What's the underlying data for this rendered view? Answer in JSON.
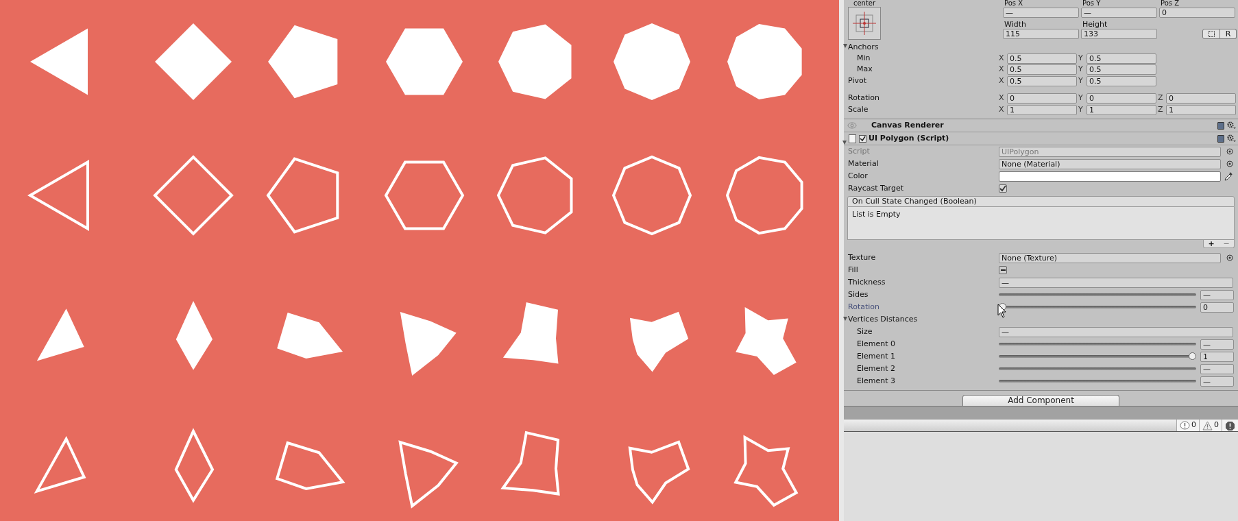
{
  "game_view": {
    "rows": [
      {
        "kind": "solid"
      },
      {
        "kind": "outline"
      },
      {
        "kind": "warped"
      },
      {
        "kind": "warped-outline"
      }
    ]
  },
  "rect_transform": {
    "preset_label": "center",
    "position": [
      {
        "label": "Pos X",
        "value": "—"
      },
      {
        "label": "Pos Y",
        "value": "—"
      },
      {
        "label": "Pos Z",
        "value": "0"
      }
    ],
    "size": [
      {
        "label": "Width",
        "value": "115"
      },
      {
        "label": "Height",
        "value": "133"
      }
    ],
    "raw_button": "R",
    "anchors": {
      "label": "Anchors",
      "expanded": true,
      "children": [
        {
          "label": "Min",
          "axes": [
            {
              "axis": "X",
              "value": "0.5"
            },
            {
              "axis": "Y",
              "value": "0.5"
            }
          ]
        },
        {
          "label": "Max",
          "axes": [
            {
              "axis": "X",
              "value": "0.5"
            },
            {
              "axis": "Y",
              "value": "0.5"
            }
          ]
        }
      ]
    },
    "pivot": {
      "label": "Pivot",
      "axes": [
        {
          "axis": "X",
          "value": "0.5"
        },
        {
          "axis": "Y",
          "value": "0.5"
        }
      ]
    },
    "transforms": [
      {
        "label": "Rotation",
        "axes": [
          {
            "axis": "X",
            "value": "0"
          },
          {
            "axis": "Y",
            "value": "0"
          },
          {
            "axis": "Z",
            "value": "0"
          }
        ]
      },
      {
        "label": "Scale",
        "axes": [
          {
            "axis": "X",
            "value": "1"
          },
          {
            "axis": "Y",
            "value": "1"
          },
          {
            "axis": "Z",
            "value": "1"
          }
        ]
      }
    ]
  },
  "components": [
    {
      "kind": "renderer",
      "title": "Canvas Renderer"
    },
    {
      "kind": "script",
      "title": "UI Polygon (Script)",
      "enabled": true,
      "expanded": true
    }
  ],
  "properties": [
    {
      "kind": "object",
      "label": "Script",
      "value": "UIPolygon",
      "disabled": true
    },
    {
      "kind": "object",
      "label": "Material",
      "value": "None (Material)",
      "disabled": false
    },
    {
      "kind": "color",
      "label": "Color"
    },
    {
      "kind": "checkbox",
      "label": "Raycast Target",
      "checked": true
    },
    {
      "kind": "event",
      "title": "On Cull State Changed (Boolean)",
      "empty_text": "List is Empty",
      "add": "+",
      "remove": "−"
    },
    {
      "kind": "object",
      "label": "Texture",
      "value": "None (Texture)",
      "disabled": false
    },
    {
      "kind": "checkbox",
      "label": "Fill",
      "mixed": true
    },
    {
      "kind": "text",
      "label": "Thickness",
      "value": "—"
    },
    {
      "kind": "slider",
      "label": "Sides",
      "value": "—",
      "focused": false
    },
    {
      "kind": "slider",
      "label": "Rotation",
      "value": "0",
      "level": 0,
      "focused": true
    },
    {
      "kind": "foldout",
      "label": "Vertices Distances",
      "expanded": true,
      "children": [
        {
          "kind": "text",
          "label": "Size",
          "value": "—"
        },
        {
          "kind": "slider",
          "label": "Element 0",
          "value": "—",
          "focused": false
        },
        {
          "kind": "slider",
          "label": "Element 1",
          "value": "1",
          "level": 1,
          "focused": false
        },
        {
          "kind": "slider",
          "label": "Element 2",
          "value": "—",
          "focused": false
        },
        {
          "kind": "slider",
          "label": "Element 3",
          "value": "—",
          "focused": false
        }
      ]
    }
  ],
  "add_component": "Add Component",
  "console": [
    {
      "kind": "info",
      "count": "0"
    },
    {
      "kind": "warning",
      "count": "0"
    },
    {
      "kind": "error"
    }
  ]
}
